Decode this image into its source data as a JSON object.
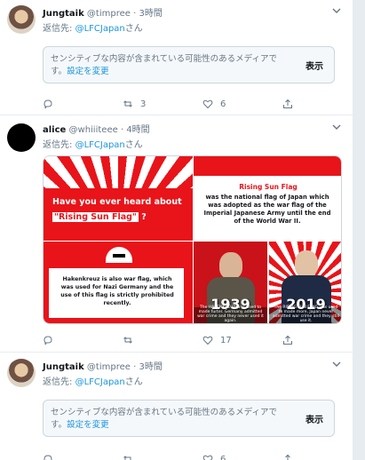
{
  "tweets": [
    {
      "name": "Jungtaik",
      "handle": "@timpree",
      "dot": "·",
      "time": "3時間",
      "reply_prefix": "返信先: ",
      "reply_mention": "@LFCJapan",
      "reply_suffix": "さん",
      "sensitive_text": "センシティブな内容が含まれている可能性のあるメディアです。",
      "sensitive_link": "設定を変更",
      "show_label": "表示",
      "retweets": "3",
      "likes": "6"
    },
    {
      "name": "alice",
      "handle": "@whiiiteee",
      "dot": "·",
      "time": "4時間",
      "reply_prefix": "返信先: ",
      "reply_mention": "@LFCJapan",
      "reply_suffix": "さん",
      "likes": "17",
      "image": {
        "p1_line1": "Have you ever heard about",
        "p1_highlight": "\"Rising Sun Flag\"",
        "p1_q": " ?",
        "p2_title": "Rising Sun Flag",
        "p2_body": "was the national flag of Japan which was adopted as the war flag of the Imperial Japanese Army until the end of the World War II.",
        "p3_body": "Hakenkreuz is also war flag, which was used for Nazi Germany and the use of this flag is strictly prohibited recently.",
        "p4_year": "1939",
        "p4_caption": "The HAKENKREUZ was used to made furter. Germany admitted war crime and they never used it again.",
        "p5_year": "2019",
        "p5_caption": "The RISING SUN FLAG was used to made more, Japan never admitted war crime and they still use it."
      }
    },
    {
      "name": "Jungtaik",
      "handle": "@timpree",
      "dot": "·",
      "time": "3時間",
      "reply_prefix": "返信先: ",
      "reply_mention": "@LFCJapan",
      "reply_suffix": "さん",
      "sensitive_text": "センシティブな内容が含まれている可能性のあるメディアです。",
      "sensitive_link": "設定を変更",
      "show_label": "表示",
      "likes": "6"
    }
  ],
  "colors": {
    "accent": "#1b95e0",
    "muted": "#657786",
    "flag_red": "#e8141a"
  },
  "icons": [
    "chevron-down-icon",
    "reply-icon",
    "retweet-icon",
    "like-icon",
    "share-icon"
  ]
}
